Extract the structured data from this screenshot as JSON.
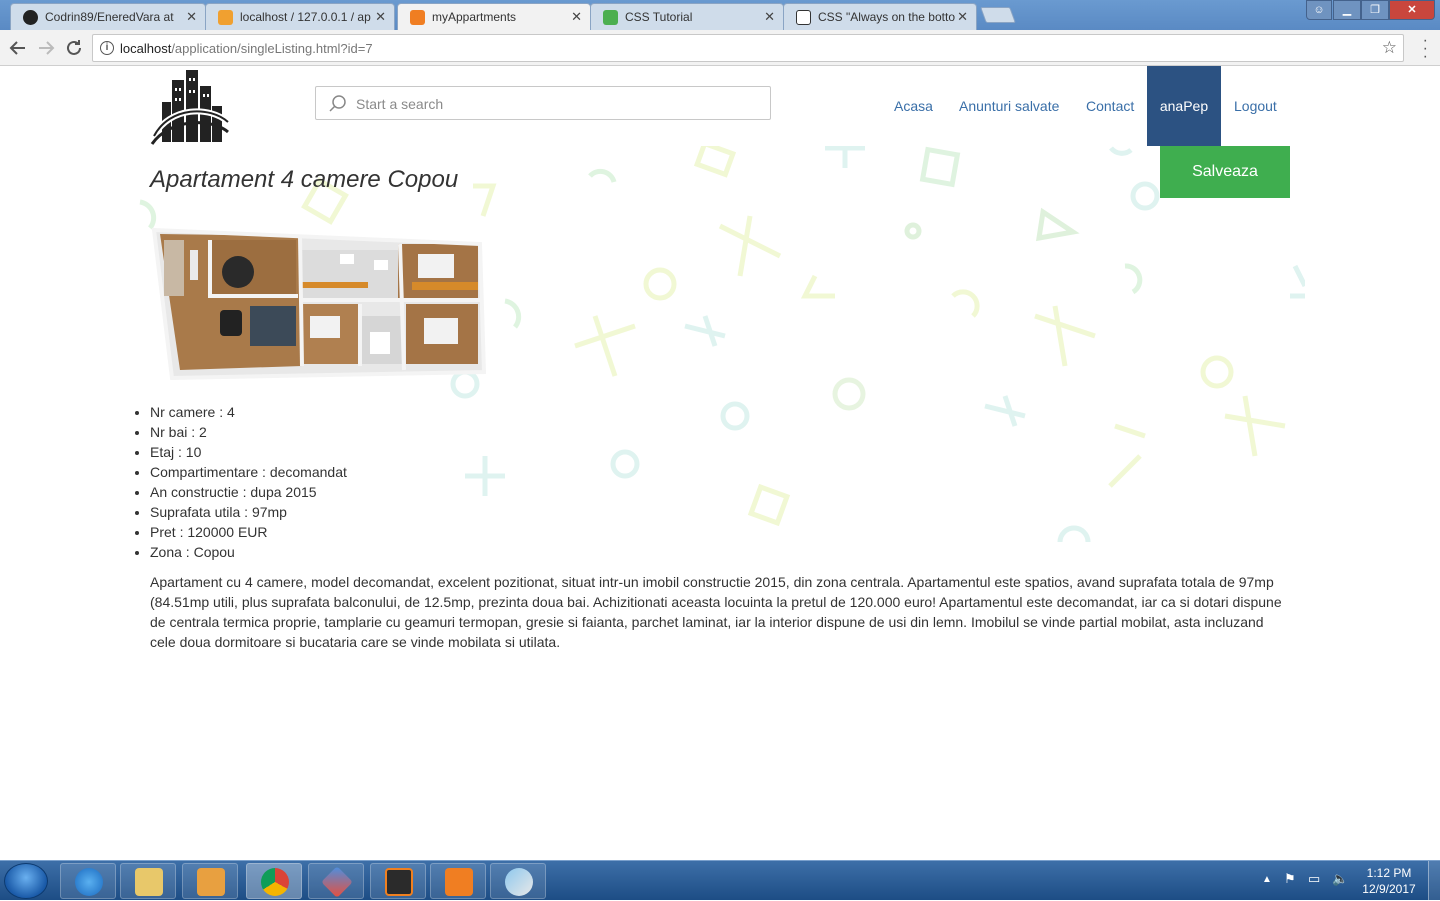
{
  "browser": {
    "tabs": [
      {
        "label": "Codrin89/EneredVara at",
        "active": false
      },
      {
        "label": "localhost / 127.0.0.1 / ap",
        "active": false
      },
      {
        "label": "myAppartments",
        "active": true
      },
      {
        "label": "CSS Tutorial",
        "active": false
      },
      {
        "label": "CSS \"Always on the botto",
        "active": false
      }
    ],
    "url_host": "localhost",
    "url_path": "/application/singleListing.html?id=7"
  },
  "header": {
    "search_placeholder": "Start a search",
    "nav": [
      "Acasa",
      "Anunturi salvate",
      "Contact"
    ],
    "user": "anaPep",
    "logout": "Logout",
    "save_button": "Salveaza"
  },
  "listing": {
    "title": "Apartament 4 camere Copou",
    "specs": [
      "Nr camere : 4",
      "Nr bai : 2",
      "Etaj : 10",
      "Compartimentare : decomandat",
      "An constructie : dupa 2015",
      "Suprafata utila : 97mp",
      "Pret : 120000 EUR",
      "Zona : Copou"
    ],
    "description": "Apartament cu 4 camere, model decomandat, excelent pozitionat, situat intr-un imobil constructie 2015, din zona centrala. Apartamentul este spatios, avand suprafata totala de 97mp (84.51mp utili, plus suprafata balconului, de 12.5mp, prezinta doua bai. Achizitionati aceasta locuinta la pretul de 120.000 euro! Apartamentul este decomandat, iar ca si dotari dispune de centrala termica proprie, tamplarie cu geamuri termopan, gresie si faianta, parchet laminat, iar la interior dispune de usi din lemn. Imobilul se vinde partial mobilat, asta incluzand cele doua dormitoare si bucataria care se vinde mobilata si utilata."
  },
  "taskbar": {
    "clock_time": "1:12 PM",
    "clock_date": "12/9/2017"
  }
}
